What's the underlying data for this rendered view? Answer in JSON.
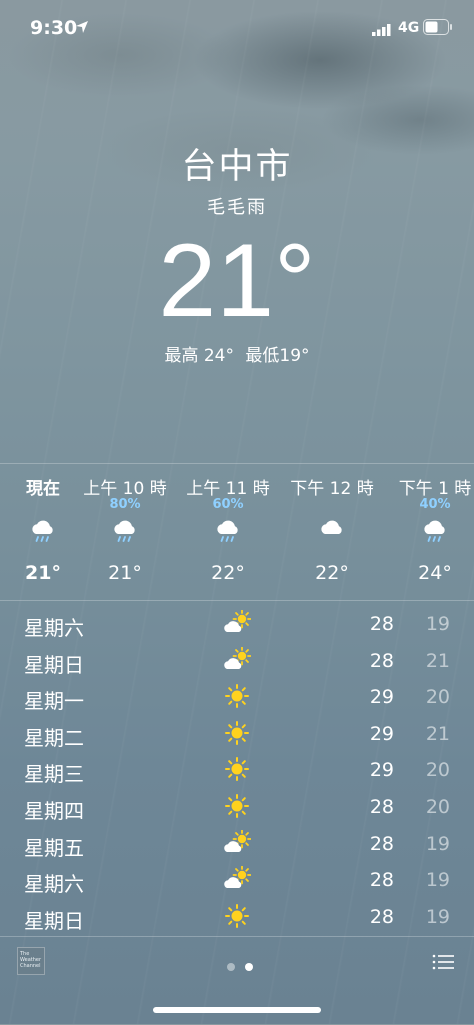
{
  "status": {
    "time": "9:30",
    "network": "4G"
  },
  "header": {
    "city": "台中市",
    "condition": "毛毛雨",
    "temperature": "21°",
    "high": "最高 24°",
    "low": "最低19°"
  },
  "hourly": [
    {
      "label": "現在",
      "pct": "",
      "icon": "cloud-rain-icon",
      "temp": "21°"
    },
    {
      "label": "上午 10 時",
      "pct": "80%",
      "icon": "cloud-rain-icon",
      "temp": "21°"
    },
    {
      "label": "上午 11 時",
      "pct": "60%",
      "icon": "cloud-rain-icon",
      "temp": "22°"
    },
    {
      "label": "下午 12 時",
      "pct": "",
      "icon": "cloud-icon",
      "temp": "22°"
    },
    {
      "label": "下午 1 時",
      "pct": "40%",
      "icon": "cloud-rain-icon",
      "temp": "24°"
    }
  ],
  "daily": [
    {
      "day": "星期六",
      "icon": "partly-cloudy-icon",
      "hi": "28",
      "lo": "19"
    },
    {
      "day": "星期日",
      "icon": "partly-cloudy-icon",
      "hi": "28",
      "lo": "21"
    },
    {
      "day": "星期一",
      "icon": "sun-icon",
      "hi": "29",
      "lo": "20"
    },
    {
      "day": "星期二",
      "icon": "sun-icon",
      "hi": "29",
      "lo": "21"
    },
    {
      "day": "星期三",
      "icon": "sun-icon",
      "hi": "29",
      "lo": "20"
    },
    {
      "day": "星期四",
      "icon": "sun-icon",
      "hi": "28",
      "lo": "20"
    },
    {
      "day": "星期五",
      "icon": "partly-cloudy-icon",
      "hi": "28",
      "lo": "19"
    },
    {
      "day": "星期六",
      "icon": "partly-cloudy-icon",
      "hi": "28",
      "lo": "19"
    },
    {
      "day": "星期日",
      "icon": "sun-icon",
      "hi": "28",
      "lo": "19"
    }
  ],
  "footer": {
    "logo_text": "The Weather Channel",
    "pages": 2,
    "active_page": 2
  },
  "colors": {
    "precip": "#8fd0ff",
    "sun": "#ffd21e"
  }
}
